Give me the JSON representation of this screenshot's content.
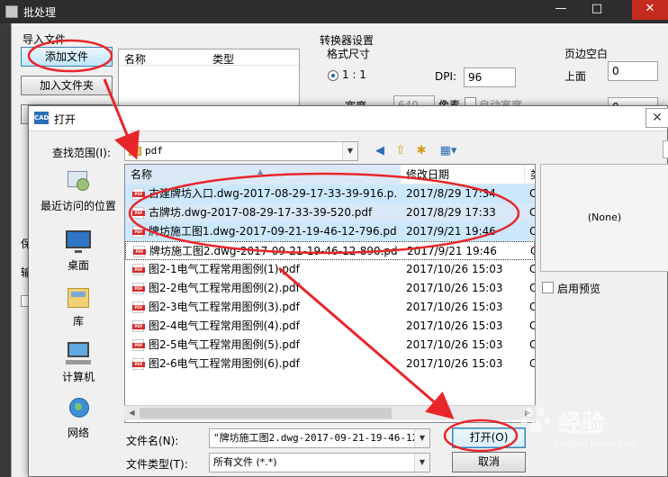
{
  "bg_window": {
    "title": "批处理",
    "caption": "",
    "import_group": "导入文件",
    "add_file_btn": "添加文件",
    "add_folder_btn": "加入文件夹",
    "list_col_name": "名称",
    "list_col_type": "类型",
    "converter_group": "转换器设置",
    "format_size": "格式尺寸",
    "ratio_label": "1 : 1",
    "dpi_label": "DPI:",
    "dpi_value": "96",
    "width_label": "宽度",
    "width_value": "640",
    "pixel_label": "像素",
    "auto_width_label": "自动宽度",
    "margin_group": "页边空白",
    "top_label": "上面",
    "top_value": "0",
    "second_margin_value": "0",
    "left_partial_1": "保",
    "left_partial_2": "输"
  },
  "dialog": {
    "title": "打开",
    "look_in_label": "查找范围(I):",
    "look_in_value": "pdf",
    "places": [
      {
        "label": "最近访问的位置",
        "icon": "recent-places-icon"
      },
      {
        "label": "桌面",
        "icon": "desktop-icon"
      },
      {
        "label": "库",
        "icon": "library-icon"
      },
      {
        "label": "计算机",
        "icon": "computer-icon"
      },
      {
        "label": "网络",
        "icon": "network-icon"
      }
    ],
    "columns": {
      "name": "名称",
      "date": "修改日期",
      "type": "类"
    },
    "files": [
      {
        "name": "古建牌坊入口.dwg-2017-08-29-17-33-39-916.p...",
        "date": "2017/8/29 17:34",
        "type": "C",
        "state": "selected"
      },
      {
        "name": "古牌坊.dwg-2017-08-29-17-33-39-520.pdf",
        "date": "2017/8/29 17:33",
        "type": "C",
        "state": "selected"
      },
      {
        "name": "牌坊施工图1.dwg-2017-09-21-19-46-12-796.pdf",
        "date": "2017/9/21 19:46",
        "type": "C",
        "state": "selected"
      },
      {
        "name": "牌坊施工图2.dwg-2017-09-21-19-46-12-890.pdf",
        "date": "2017/9/21 19:46",
        "type": "C",
        "state": "focused"
      },
      {
        "name": "图2-1电气工程常用图例(1).pdf",
        "date": "2017/10/26 15:03",
        "type": "C",
        "state": "normal"
      },
      {
        "name": "图2-2电气工程常用图例(2).pdf",
        "date": "2017/10/26 15:03",
        "type": "C",
        "state": "normal"
      },
      {
        "name": "图2-3电气工程常用图例(3).pdf",
        "date": "2017/10/26 15:03",
        "type": "C",
        "state": "normal"
      },
      {
        "name": "图2-4电气工程常用图例(4).pdf",
        "date": "2017/10/26 15:03",
        "type": "C",
        "state": "normal"
      },
      {
        "name": "图2-5电气工程常用图例(5).pdf",
        "date": "2017/10/26 15:03",
        "type": "C",
        "state": "normal"
      },
      {
        "name": "图2-6电气工程常用图例(6).pdf",
        "date": "2017/10/26 15:03",
        "type": "C",
        "state": "normal"
      }
    ],
    "preview_text": "(None)",
    "enable_preview_label": "启用预览",
    "filename_label": "文件名(N):",
    "filename_value": "\"牌坊施工图2.dwg-2017-09-21-19-46-12-",
    "filetype_label": "文件类型(T):",
    "filetype_value": "所有文件 (*.*)",
    "open_btn": "打开(O)",
    "cancel_btn": "取消"
  },
  "watermark": {
    "text": "经验",
    "sub": "jingyan.baidu.com"
  },
  "colors": {
    "annotation": "#e8262a",
    "selection": "#cce8ff",
    "accent": "#3c7fb1"
  }
}
